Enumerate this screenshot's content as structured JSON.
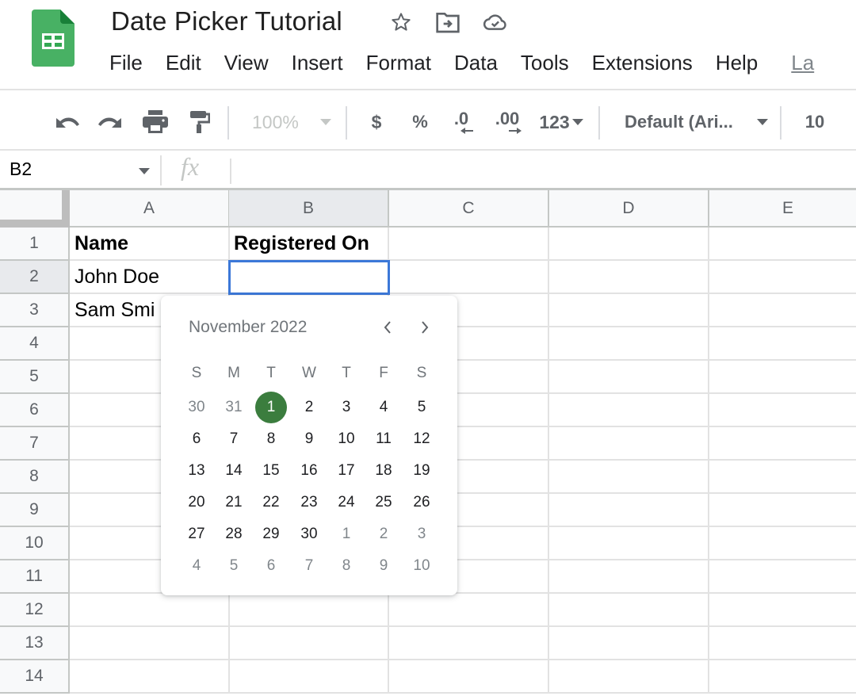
{
  "app": {
    "document_title": "Date Picker Tutorial",
    "title_icons": [
      "star-icon",
      "move-to-folder-icon",
      "cloud-saved-icon"
    ],
    "menu": [
      "File",
      "Edit",
      "View",
      "Insert",
      "Format",
      "Data",
      "Tools",
      "Extensions",
      "Help",
      "La"
    ]
  },
  "toolbar": {
    "icons": [
      "undo-icon",
      "redo-icon",
      "print-icon",
      "paint-format-icon"
    ],
    "zoom": "100%",
    "currency": "$",
    "percent": "%",
    "decrease_decimal": ".0",
    "increase_decimal": ".00",
    "number_format": "123",
    "font": "Default (Ari...",
    "font_size": "10"
  },
  "formula_bar": {
    "name_box": "B2",
    "fx_label": "fx",
    "value": ""
  },
  "sheet": {
    "columns": [
      "A",
      "B",
      "C",
      "D",
      "E"
    ],
    "selected_column": "B",
    "rows": [
      "1",
      "2",
      "3",
      "4",
      "5",
      "6",
      "7",
      "8",
      "9",
      "10",
      "11",
      "12",
      "13",
      "14"
    ],
    "selected_row": "2",
    "cells": {
      "A1": "Name",
      "B1": "Registered On",
      "A2": "John Doe",
      "A3": "Sam Smi"
    },
    "active_cell": "B2"
  },
  "date_picker": {
    "month_label": "November 2022",
    "prev_label": "‹",
    "next_label": "›",
    "weekdays": [
      "S",
      "M",
      "T",
      "W",
      "T",
      "F",
      "S"
    ],
    "selected_day": "1",
    "selected_color": "#3b7d3e",
    "weeks": [
      [
        {
          "d": "30",
          "o": true
        },
        {
          "d": "31",
          "o": true
        },
        {
          "d": "1",
          "s": true
        },
        {
          "d": "2"
        },
        {
          "d": "3"
        },
        {
          "d": "4"
        },
        {
          "d": "5"
        }
      ],
      [
        {
          "d": "6"
        },
        {
          "d": "7"
        },
        {
          "d": "8"
        },
        {
          "d": "9"
        },
        {
          "d": "10"
        },
        {
          "d": "11"
        },
        {
          "d": "12"
        }
      ],
      [
        {
          "d": "13"
        },
        {
          "d": "14"
        },
        {
          "d": "15"
        },
        {
          "d": "16"
        },
        {
          "d": "17"
        },
        {
          "d": "18"
        },
        {
          "d": "19"
        }
      ],
      [
        {
          "d": "20"
        },
        {
          "d": "21"
        },
        {
          "d": "22"
        },
        {
          "d": "23"
        },
        {
          "d": "24"
        },
        {
          "d": "25"
        },
        {
          "d": "26"
        }
      ],
      [
        {
          "d": "27"
        },
        {
          "d": "28"
        },
        {
          "d": "29"
        },
        {
          "d": "30"
        },
        {
          "d": "1",
          "o": true
        },
        {
          "d": "2",
          "o": true
        },
        {
          "d": "3",
          "o": true
        }
      ],
      [
        {
          "d": "4",
          "o": true
        },
        {
          "d": "5",
          "o": true
        },
        {
          "d": "6",
          "o": true
        },
        {
          "d": "7",
          "o": true
        },
        {
          "d": "8",
          "o": true
        },
        {
          "d": "9",
          "o": true
        },
        {
          "d": "10",
          "o": true
        }
      ]
    ]
  }
}
